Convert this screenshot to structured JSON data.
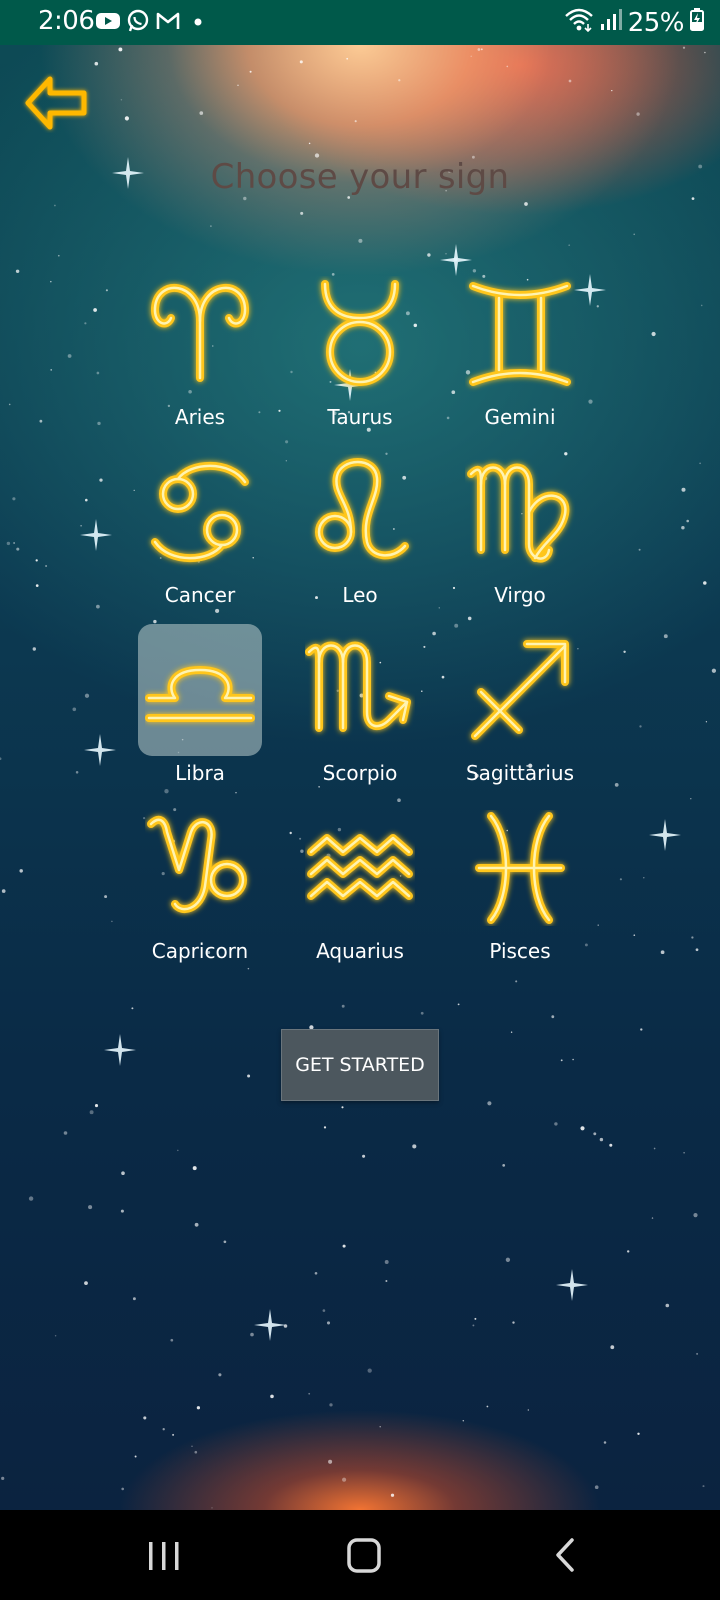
{
  "status_bar": {
    "time": "2:06",
    "battery": "25%",
    "notification_icons": [
      "youtube-icon",
      "whatsapp-icon",
      "gmail-icon",
      "dot-icon"
    ],
    "system_icons": [
      "wifi-icon",
      "signal-icon",
      "battery-charging-icon"
    ]
  },
  "header": {
    "back_icon": "arrow-left-icon",
    "title": "Choose your sign"
  },
  "signs": [
    {
      "label": "Aries",
      "icon": "aries-icon",
      "selected": false
    },
    {
      "label": "Taurus",
      "icon": "taurus-icon",
      "selected": false
    },
    {
      "label": "Gemini",
      "icon": "gemini-icon",
      "selected": false
    },
    {
      "label": "Cancer",
      "icon": "cancer-icon",
      "selected": false
    },
    {
      "label": "Leo",
      "icon": "leo-icon",
      "selected": false
    },
    {
      "label": "Virgo",
      "icon": "virgo-icon",
      "selected": false
    },
    {
      "label": "Libra",
      "icon": "libra-icon",
      "selected": true
    },
    {
      "label": "Scorpio",
      "icon": "scorpio-icon",
      "selected": false
    },
    {
      "label": "Sagittarius",
      "icon": "sagittarius-icon",
      "selected": false
    },
    {
      "label": "Capricorn",
      "icon": "capricorn-icon",
      "selected": false
    },
    {
      "label": "Aquarius",
      "icon": "aquarius-icon",
      "selected": false
    },
    {
      "label": "Pisces",
      "icon": "pisces-icon",
      "selected": false
    }
  ],
  "actions": {
    "get_started_label": "GET STARTED"
  },
  "nav_bar": {
    "buttons": [
      "recent-apps-icon",
      "home-icon",
      "back-icon"
    ]
  },
  "colors": {
    "status_bar": "#00594a",
    "neon_gold": "#ffc61a",
    "title": "#5e4a45",
    "button": "#4c575e"
  }
}
